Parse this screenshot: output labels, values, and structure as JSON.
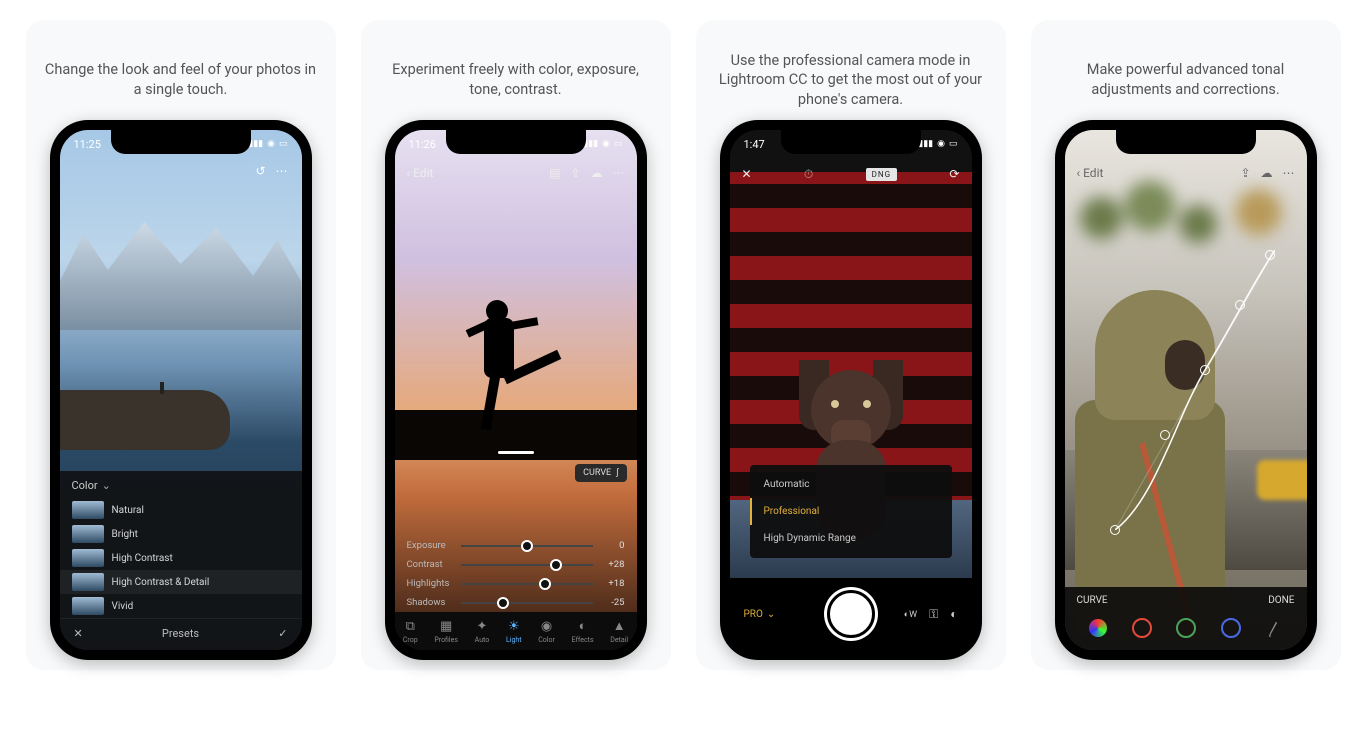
{
  "panels": [
    {
      "caption": "Change the look and feel of your photos in a single touch.",
      "status_time": "11:25",
      "preset_header": "Color",
      "presets": [
        "Natural",
        "Bright",
        "High Contrast",
        "High Contrast & Detail",
        "Vivid"
      ],
      "presets_bar_label": "Presets"
    },
    {
      "caption": "Experiment freely with color, exposure, tone, contrast.",
      "status_time": "11:26",
      "edit_label": "Edit",
      "curve_label": "CURVE",
      "sliders": [
        {
          "label": "Exposure",
          "value": "0",
          "pos": 50
        },
        {
          "label": "Contrast",
          "value": "+28",
          "pos": 72
        },
        {
          "label": "Highlights",
          "value": "+18",
          "pos": 64
        },
        {
          "label": "Shadows",
          "value": "-25",
          "pos": 32
        }
      ],
      "toolbar": [
        "Crop",
        "Profiles",
        "Auto",
        "Light",
        "Color",
        "Effects",
        "Detail"
      ],
      "toolbar_active": "Light"
    },
    {
      "caption": "Use the professional camera mode in Lightroom CC to get the most out of your phone's camera.",
      "status_time": "1:47",
      "dng_label": "DNG",
      "modes": [
        "Automatic",
        "Professional",
        "High Dynamic Range"
      ],
      "mode_selected": "Professional",
      "pro_label": "PRO",
      "wb_label": "W"
    },
    {
      "caption": "Make powerful advanced tonal adjustments and corrections.",
      "edit_label": "Edit",
      "curve_label": "CURVE",
      "done_label": "DONE",
      "channels": [
        "rgb",
        "red",
        "green",
        "blue",
        "gray"
      ]
    }
  ]
}
